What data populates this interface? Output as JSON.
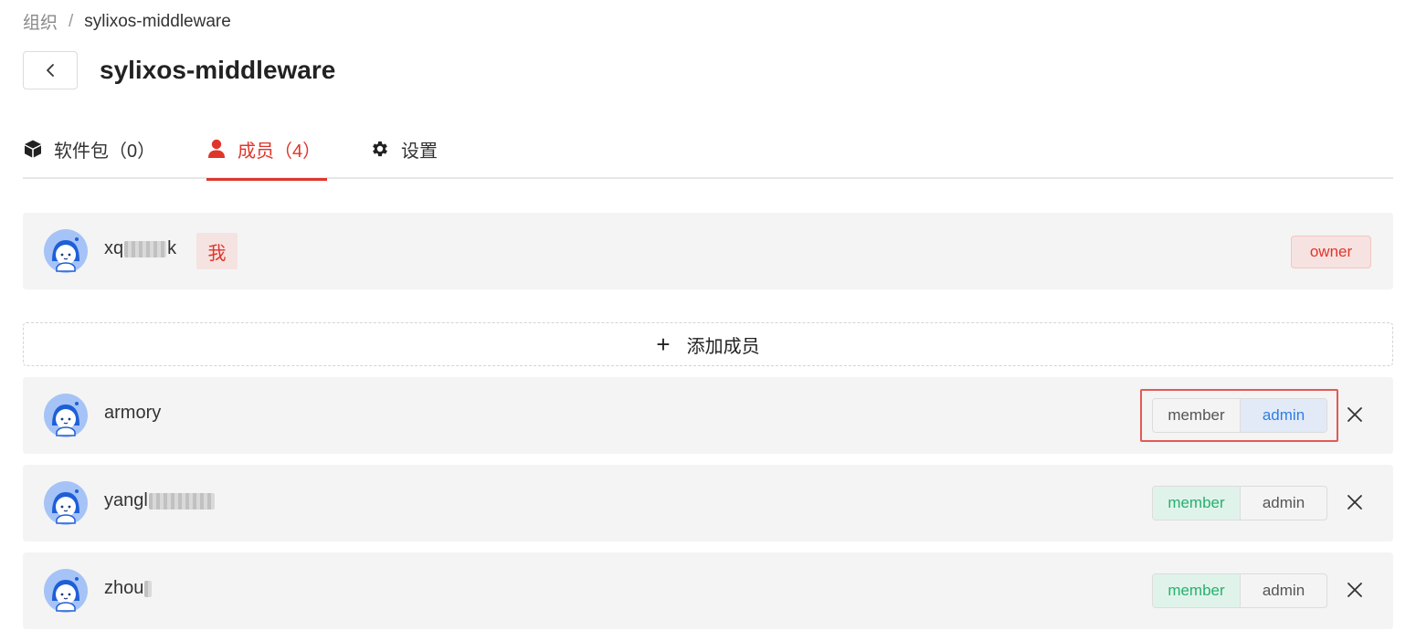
{
  "breadcrumb": {
    "root": "组织",
    "separator": "/",
    "current": "sylixos-middleware"
  },
  "header": {
    "title": "sylixos-middleware"
  },
  "tabs": [
    {
      "label": "软件包（0）",
      "icon": "cube-icon",
      "active": false
    },
    {
      "label": "成员（4）",
      "icon": "user-icon",
      "active": true
    },
    {
      "label": "设置",
      "icon": "gear-icon",
      "active": false
    }
  ],
  "owner_row": {
    "name_prefix": "xq",
    "name_suffix": "k",
    "me_label": "我",
    "role_label": "owner"
  },
  "add_member": {
    "icon": "plus-icon",
    "label": "添加成员"
  },
  "members": [
    {
      "name_prefix": "armory",
      "role_member": "member",
      "role_admin": "admin",
      "selected": "admin"
    },
    {
      "name_prefix": "yangl",
      "role_member": "member",
      "role_admin": "admin",
      "selected": "member"
    },
    {
      "name_prefix": "zhou",
      "role_member": "member",
      "role_admin": "admin",
      "selected": "member"
    }
  ],
  "colors": {
    "accent": "#e0352b",
    "admin_selected": "#2f7ee6",
    "member_selected": "#27b06e",
    "row_bg": "#f4f4f4"
  }
}
